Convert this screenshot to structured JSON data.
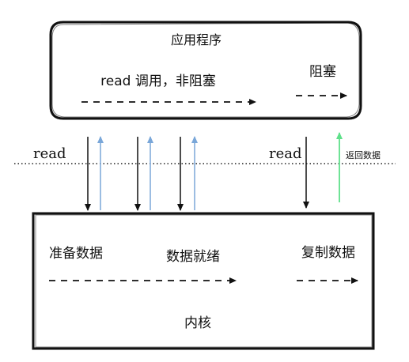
{
  "application": {
    "title": "应用程序",
    "read_nonblocking_label": "read 调用，非阻塞",
    "blocking_label": "阻塞"
  },
  "boundary": {
    "left_read_label": "read",
    "right_read_label": "read",
    "return_data_label": "返回数据"
  },
  "kernel": {
    "title": "内核",
    "prepare_data_label": "准备数据",
    "data_ready_label": "数据就绪",
    "copy_data_label": "复制数据"
  },
  "colors": {
    "outline": "#111111",
    "request_arrow": "#111111",
    "poll_reply_arrow": "#7aa7d9",
    "return_arrow": "#5fe08a",
    "boundary_line": "#222222"
  }
}
